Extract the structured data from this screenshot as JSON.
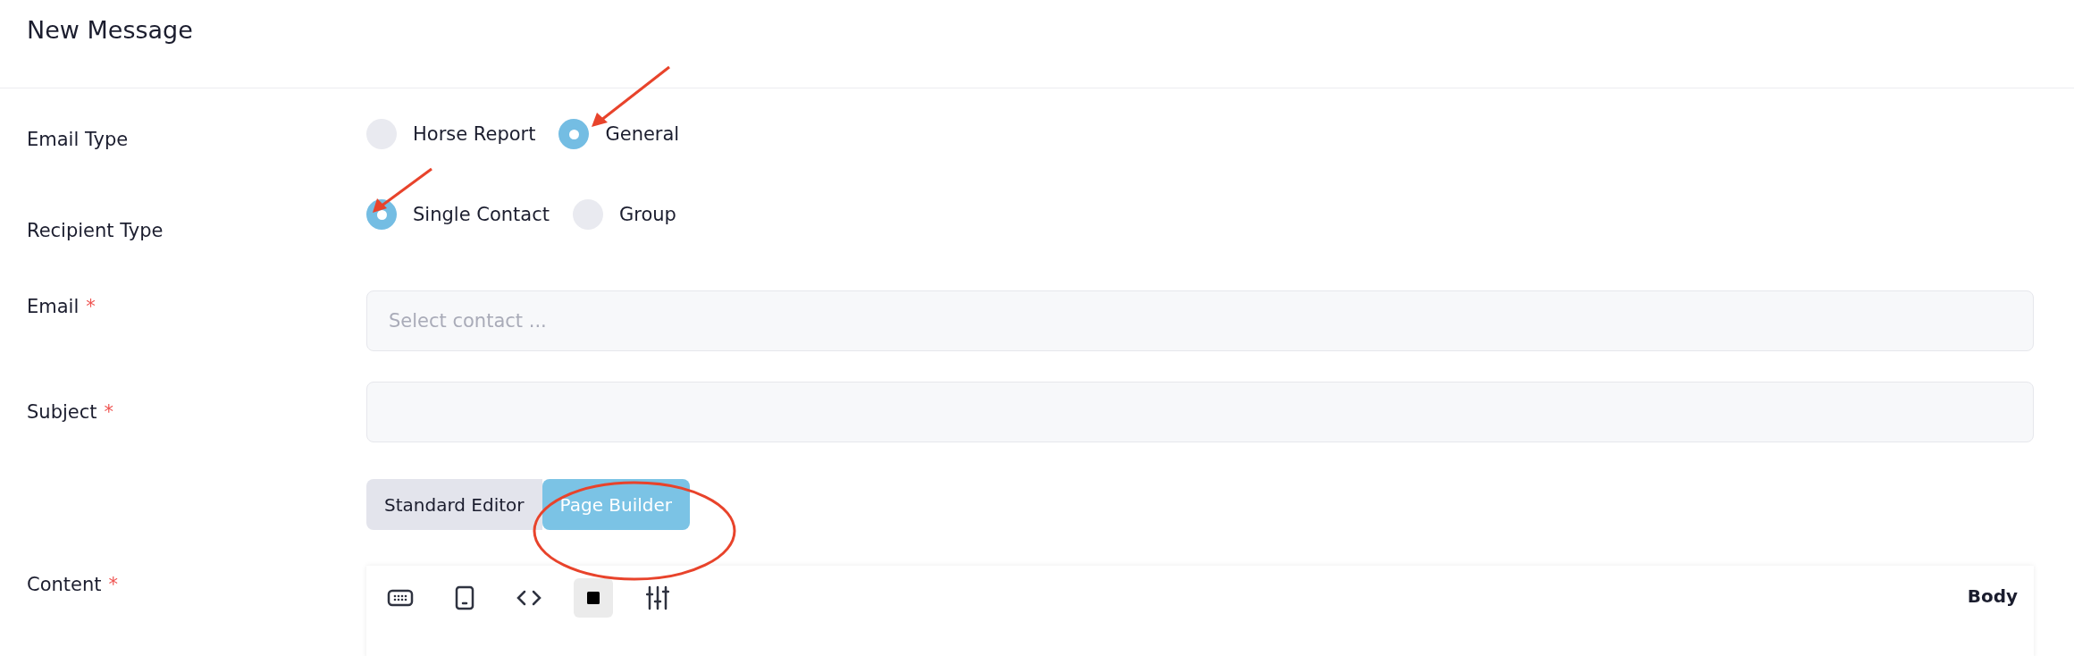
{
  "title": "New Message",
  "fields": [
    {
      "kind": "radio",
      "label": "Email Type",
      "options": [
        {
          "label": "Horse Report",
          "selected": false
        },
        {
          "label": "General",
          "selected": true
        }
      ]
    },
    {
      "kind": "radio",
      "label": "Recipient Type",
      "options": [
        {
          "label": "Single Contact",
          "selected": true
        },
        {
          "label": "Group",
          "selected": false
        }
      ]
    },
    {
      "kind": "select",
      "label": "Email",
      "required_mark": "*",
      "placeholder": "Select contact ..."
    },
    {
      "kind": "text",
      "label": "Subject",
      "required_mark": "*"
    },
    {
      "kind": "editor",
      "label": "Content",
      "required_mark": "*",
      "modes": [
        {
          "label": "Standard Editor",
          "selected": false
        },
        {
          "label": "Page Builder",
          "selected": true
        }
      ],
      "toolbar": [
        {
          "kind": "keyboard",
          "selected": false
        },
        {
          "kind": "tablet",
          "selected": false
        },
        {
          "kind": "code",
          "selected": false
        },
        {
          "kind": "square",
          "selected": true
        },
        {
          "kind": "sliders",
          "selected": false
        }
      ],
      "section": "Body"
    }
  ]
}
